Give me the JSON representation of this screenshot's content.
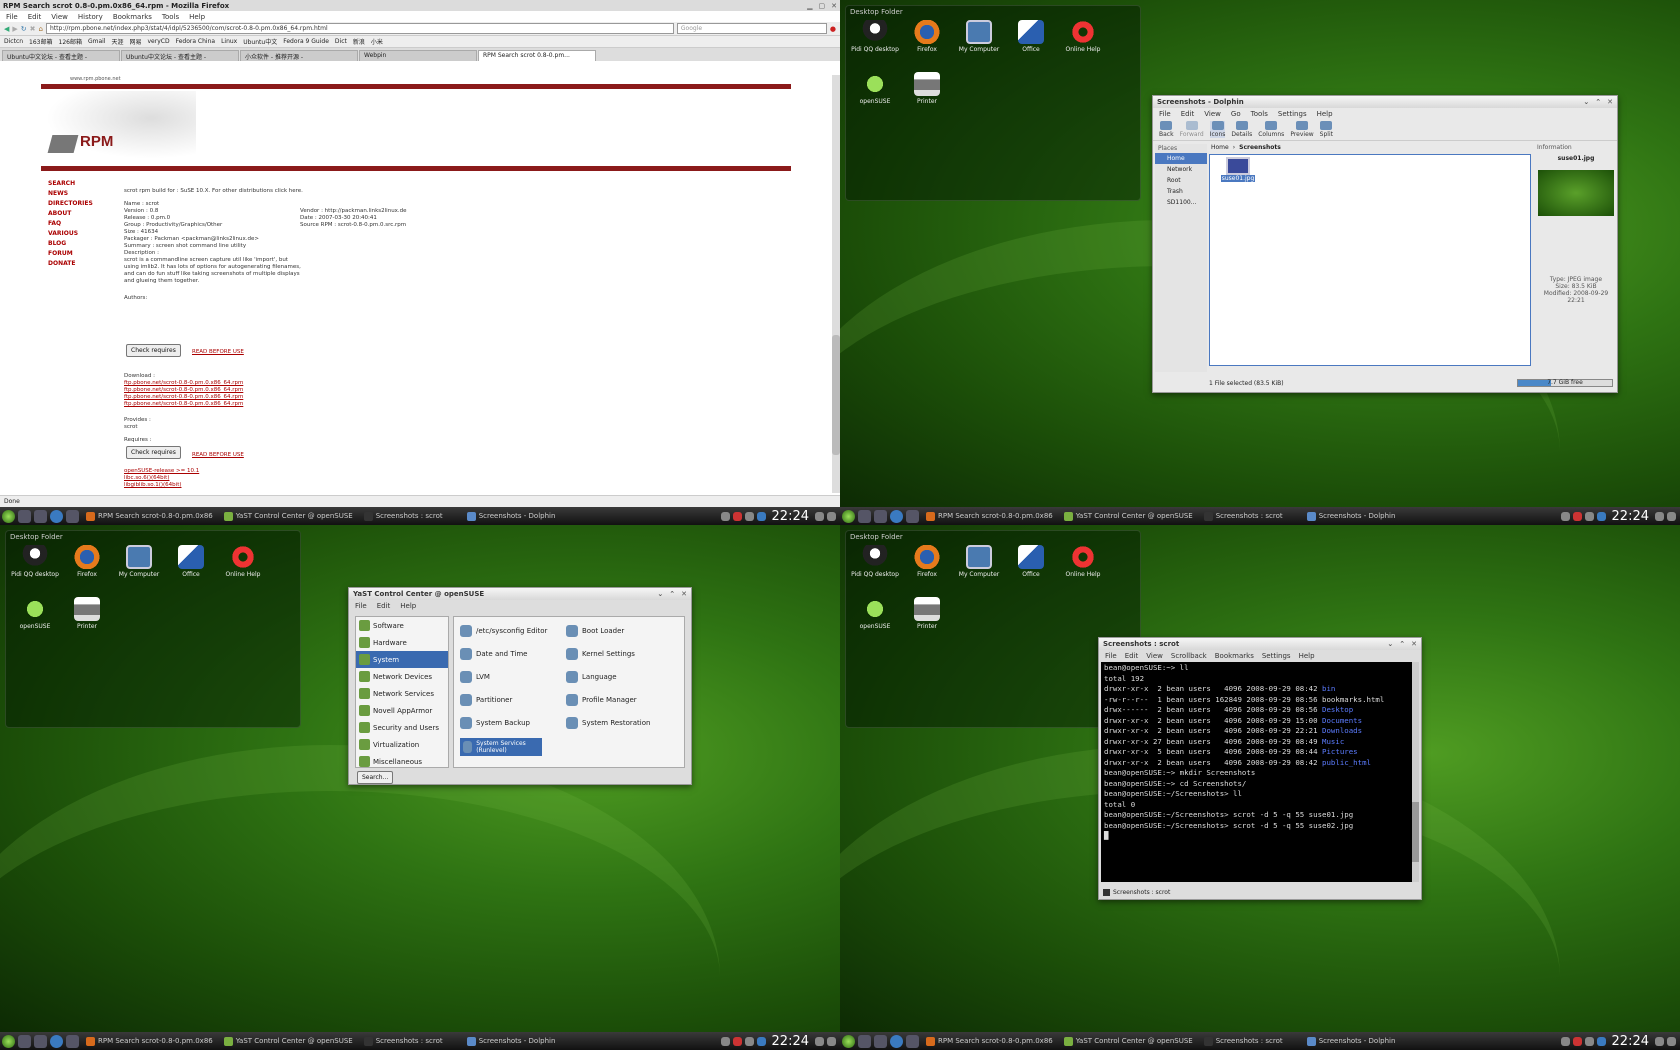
{
  "panel": {
    "clock": "22:24",
    "tasks": [
      "RPM Search scrot-0.8-0.pm.0x86",
      "YaST Control Center @ openSUSE",
      "Screenshots : scrot",
      "Screenshots - Dolphin"
    ]
  },
  "folder_view": {
    "title": "Desktop Folder",
    "icons": [
      "Pidi QQ desktop",
      "Firefox",
      "My Computer",
      "Office",
      "Online Help",
      "openSUSE",
      "Printer"
    ]
  },
  "firefox": {
    "title": "RPM Search scrot 0.8-0.pm.0x86_64.rpm - Mozilla Firefox",
    "menu": [
      "File",
      "Edit",
      "View",
      "History",
      "Bookmarks",
      "Tools",
      "Help"
    ],
    "url": "http://rpm.pbone.net/index.php3/stat/4/idpl/5236500/com/scrot-0.8-0.pm.0x86_64.rpm.html",
    "search_placeholder": "Google",
    "bookmarks": [
      "Dictcn",
      "163邮箱",
      "126邮箱",
      "Gmail",
      "天涯",
      "网易",
      "veryCD",
      "Fedora China",
      "Linux",
      "Ubuntu中文",
      "Fedora 9 Guide",
      "Dict",
      "新浪",
      "小米"
    ],
    "tabs": [
      "Ubuntu中文论坛 - 查看主题 -",
      "Ubuntu中文论坛 - 查看主题 -",
      "小众软件 - 推荐开源 -",
      "Webpin",
      "RPM Search scrot 0.8-0.pm..."
    ],
    "status": "Done",
    "page": {
      "header_link": "www.rpm.pbone.net",
      "nav": [
        "SEARCH",
        "NEWS",
        "DIRECTORIES",
        "ABOUT",
        "FAQ",
        "VARIOUS",
        "BLOG",
        "FORUM",
        "DONATE"
      ],
      "intro": "scrot rpm build for : SuSE 10.X. For other distributions click here.",
      "details_left": [
        "Name : scrot",
        "Version : 0.8",
        "Release : 0.pm.0",
        "Group : Productivity/Graphics/Other",
        "Size : 41634",
        "Packager : Packman <packman@links2linux.de>",
        "Summary : screen shot command line utility",
        "Description :"
      ],
      "details_right": [
        "Vendor : http://packman.links2linux.de",
        "Date : 2007-03-30 20:40:41",
        "Source RPM : scrot-0.8-0.pm.0.src.rpm"
      ],
      "description": "scrot is a commandline screen capture util like 'import', but using imlib2. It has lots of options for autogenerating filenames, and can do fun stuff like taking screenshots of multiple displays and glueing them together.",
      "authors_label": "Authors:",
      "provides_label": "Provides :",
      "provides_value": "scrot",
      "requires_label": "Requires :",
      "check_requires": "Check requires",
      "read_before": "READ BEFORE USE",
      "download_label": "Download :",
      "downloads": [
        "ftp.pbone.net/scrot-0.8-0.pm.0.x86_64.rpm",
        "ftp.pbone.net/scrot-0.8-0.pm.0.x86_64.rpm",
        "ftp.pbone.net/scrot-0.8-0.pm.0.x86_64.rpm",
        "ftp.pbone.net/scrot-0.8-0.pm.0.x86_64.rpm"
      ],
      "requires_list": [
        "openSUSE-release >= 10.1",
        "libc.so.6()(64bit)",
        "libgiblib.so.1()(64bit)"
      ]
    }
  },
  "dolphin": {
    "title": "Screenshots - Dolphin",
    "menu": [
      "File",
      "Edit",
      "View",
      "Go",
      "Tools",
      "Settings",
      "Help"
    ],
    "toolbar": [
      "Back",
      "Forward",
      "Icons",
      "Details",
      "Columns",
      "Preview",
      "Split"
    ],
    "places_title": "Places",
    "places": [
      "Home",
      "Network",
      "Root",
      "Trash",
      "SD1100..."
    ],
    "breadcrumb": [
      "Home",
      "Screenshots"
    ],
    "file": "suse01.jpg",
    "info_title": "Information",
    "info_name": "suse01.jpg",
    "status": "1 File selected (83.5 KiB)",
    "free": "7.7 GiB free",
    "info_fields": [
      "Type: JPEG image",
      "Size: 83.5 KiB",
      "Modified: 2008-09-29 22:21"
    ]
  },
  "yast": {
    "title": "YaST Control Center @ openSUSE",
    "menu": [
      "File",
      "Edit",
      "Help"
    ],
    "categories": [
      "Software",
      "Hardware",
      "System",
      "Network Devices",
      "Network Services",
      "Novell AppArmor",
      "Security and Users",
      "Virtualization",
      "Miscellaneous"
    ],
    "selected": "System",
    "modules": [
      "/etc/sysconfig Editor",
      "Boot Loader",
      "Date and Time",
      "Kernel Settings",
      "LVM",
      "Language",
      "Partitioner",
      "Profile Manager",
      "System Backup",
      "System Restoration",
      "System Services (Runlevel)"
    ],
    "search": "Search..."
  },
  "konsole": {
    "title": "Screenshots : scrot",
    "menu": [
      "File",
      "Edit",
      "View",
      "Scrollback",
      "Bookmarks",
      "Settings",
      "Help"
    ],
    "tab": "Screenshots : scrot",
    "lines": [
      {
        "t": "bean@openSUSE:~> ll"
      },
      {
        "t": "total 192"
      },
      {
        "t": "drwxr-xr-x  2 bean users   4096 2008-09-29 08:42 ",
        "d": "bin"
      },
      {
        "t": "-rw-r--r--  1 bean users 162849 2008-09-29 08:56 bookmarks.html"
      },
      {
        "t": "drwx------  2 bean users   4096 2008-09-29 08:56 ",
        "d": "Desktop"
      },
      {
        "t": "drwxr-xr-x  2 bean users   4096 2008-09-29 15:00 ",
        "d": "Documents"
      },
      {
        "t": "drwxr-xr-x  2 bean users   4096 2008-09-29 22:21 ",
        "d": "Downloads"
      },
      {
        "t": "drwxr-xr-x 27 bean users   4096 2008-09-29 08:49 ",
        "d": "Music"
      },
      {
        "t": "drwxr-xr-x  5 bean users   4096 2008-09-29 08:44 ",
        "d": "Pictures"
      },
      {
        "t": "drwxr-xr-x  2 bean users   4096 2008-09-29 08:42 ",
        "d": "public_html"
      },
      {
        "t": "bean@openSUSE:~> mkdir Screenshots"
      },
      {
        "t": "bean@openSUSE:~> cd Screenshots/"
      },
      {
        "t": "bean@openSUSE:~/Screenshots> ll"
      },
      {
        "t": "total 0"
      },
      {
        "t": "bean@openSUSE:~/Screenshots> scrot -d 5 -q 55 suse01.jpg"
      },
      {
        "t": "bean@openSUSE:~/Screenshots> scrot -d 5 -q 55 suse02.jpg"
      },
      {
        "t": "█"
      }
    ]
  }
}
